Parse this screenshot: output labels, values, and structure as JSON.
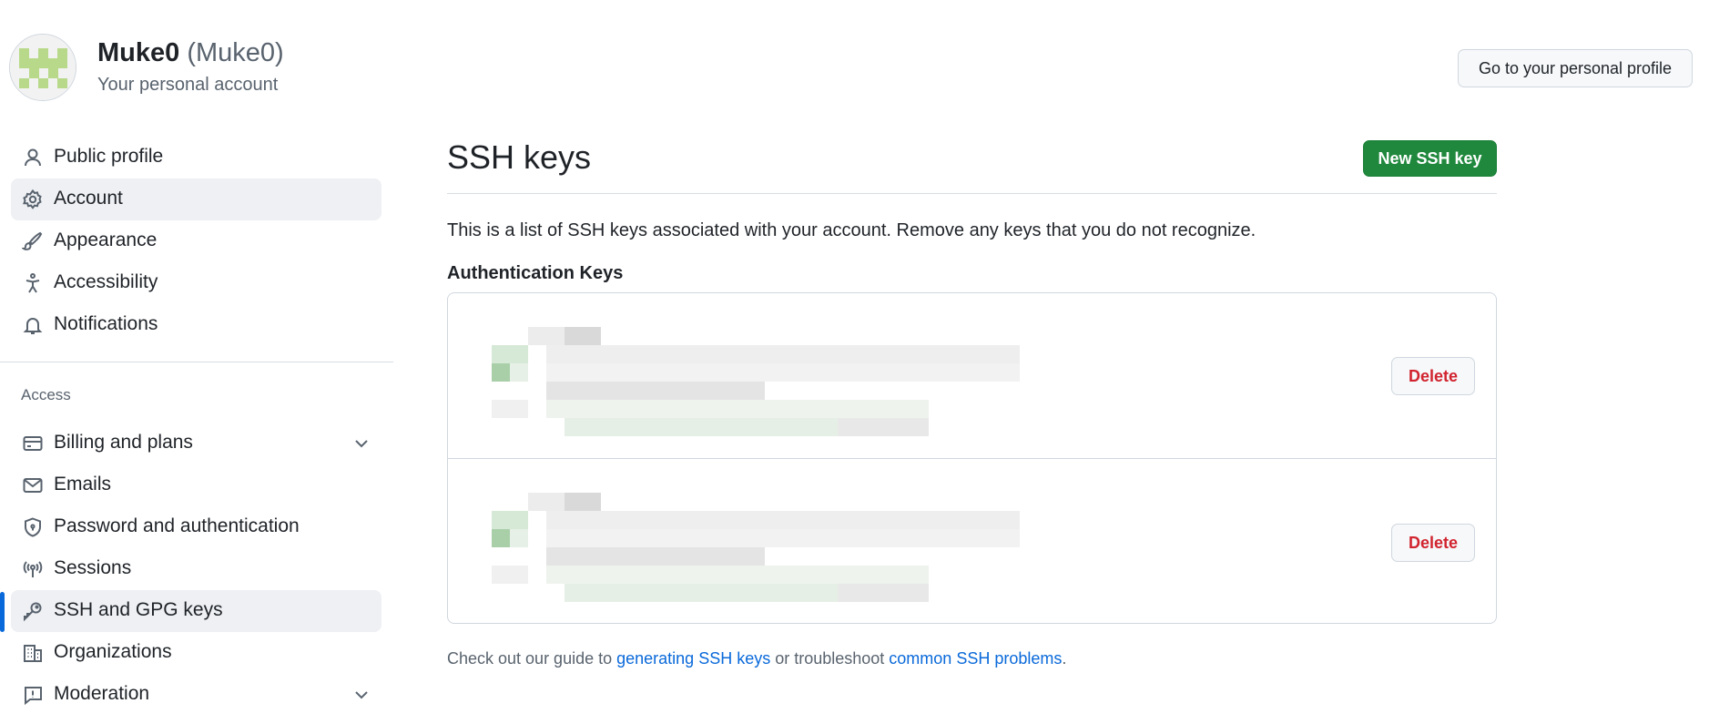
{
  "header": {
    "display_name": "Muke0",
    "login": "(Muke0)",
    "subtitle": "Your personal account",
    "profile_button": "Go to your personal profile"
  },
  "sidebar": {
    "items": [
      {
        "label": "Public profile",
        "icon": "person-icon"
      },
      {
        "label": "Account",
        "icon": "gear-icon",
        "selected": true
      },
      {
        "label": "Appearance",
        "icon": "paintbrush-icon"
      },
      {
        "label": "Accessibility",
        "icon": "accessibility-icon"
      },
      {
        "label": "Notifications",
        "icon": "bell-icon"
      }
    ],
    "section_label": "Access",
    "access_items": [
      {
        "label": "Billing and plans",
        "icon": "credit-card-icon",
        "expandable": true
      },
      {
        "label": "Emails",
        "icon": "mail-icon"
      },
      {
        "label": "Password and authentication",
        "icon": "shield-lock-icon"
      },
      {
        "label": "Sessions",
        "icon": "broadcast-icon"
      },
      {
        "label": "SSH and GPG keys",
        "icon": "key-icon",
        "active": true
      },
      {
        "label": "Organizations",
        "icon": "organization-icon"
      },
      {
        "label": "Moderation",
        "icon": "report-icon",
        "expandable": true
      }
    ]
  },
  "main": {
    "title": "SSH keys",
    "new_button": "New SSH key",
    "description": "This is a list of SSH keys associated with your account. Remove any keys that you do not recognize.",
    "auth_heading": "Authentication Keys",
    "keys": [
      {
        "delete_label": "Delete"
      },
      {
        "delete_label": "Delete"
      }
    ],
    "footer": {
      "prefix": "Check out our guide to ",
      "link1": "generating SSH keys",
      "middle": " or troubleshoot ",
      "link2": "common SSH problems",
      "suffix": "."
    }
  },
  "colors": {
    "primary_button": "#1f883d",
    "danger_text": "#d1242f",
    "link": "#0969da",
    "active_indicator": "#0969da",
    "selected_bg": "#eef0f3"
  }
}
